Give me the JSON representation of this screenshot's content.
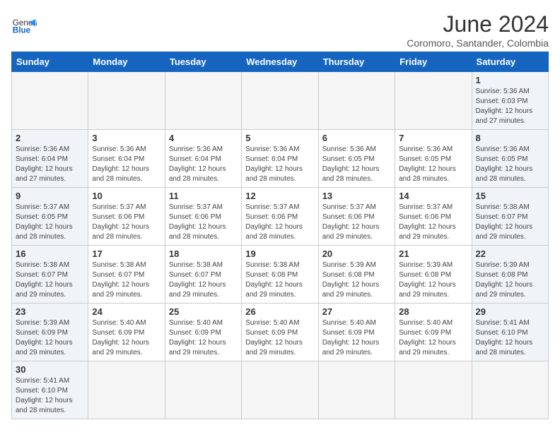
{
  "header": {
    "logo_text_normal": "General",
    "logo_text_blue": "Blue",
    "month_title": "June 2024",
    "subtitle": "Coromoro, Santander, Colombia"
  },
  "weekdays": [
    "Sunday",
    "Monday",
    "Tuesday",
    "Wednesday",
    "Thursday",
    "Friday",
    "Saturday"
  ],
  "weeks": [
    [
      {
        "day": "",
        "info": ""
      },
      {
        "day": "",
        "info": ""
      },
      {
        "day": "",
        "info": ""
      },
      {
        "day": "",
        "info": ""
      },
      {
        "day": "",
        "info": ""
      },
      {
        "day": "",
        "info": ""
      },
      {
        "day": "1",
        "info": "Sunrise: 5:36 AM\nSunset: 6:03 PM\nDaylight: 12 hours\nand 27 minutes."
      }
    ],
    [
      {
        "day": "2",
        "info": "Sunrise: 5:36 AM\nSunset: 6:04 PM\nDaylight: 12 hours\nand 27 minutes."
      },
      {
        "day": "3",
        "info": "Sunrise: 5:36 AM\nSunset: 6:04 PM\nDaylight: 12 hours\nand 28 minutes."
      },
      {
        "day": "4",
        "info": "Sunrise: 5:36 AM\nSunset: 6:04 PM\nDaylight: 12 hours\nand 28 minutes."
      },
      {
        "day": "5",
        "info": "Sunrise: 5:36 AM\nSunset: 6:04 PM\nDaylight: 12 hours\nand 28 minutes."
      },
      {
        "day": "6",
        "info": "Sunrise: 5:36 AM\nSunset: 6:05 PM\nDaylight: 12 hours\nand 28 minutes."
      },
      {
        "day": "7",
        "info": "Sunrise: 5:36 AM\nSunset: 6:05 PM\nDaylight: 12 hours\nand 28 minutes."
      },
      {
        "day": "8",
        "info": "Sunrise: 5:36 AM\nSunset: 6:05 PM\nDaylight: 12 hours\nand 28 minutes."
      }
    ],
    [
      {
        "day": "9",
        "info": "Sunrise: 5:37 AM\nSunset: 6:05 PM\nDaylight: 12 hours\nand 28 minutes."
      },
      {
        "day": "10",
        "info": "Sunrise: 5:37 AM\nSunset: 6:06 PM\nDaylight: 12 hours\nand 28 minutes."
      },
      {
        "day": "11",
        "info": "Sunrise: 5:37 AM\nSunset: 6:06 PM\nDaylight: 12 hours\nand 28 minutes."
      },
      {
        "day": "12",
        "info": "Sunrise: 5:37 AM\nSunset: 6:06 PM\nDaylight: 12 hours\nand 28 minutes."
      },
      {
        "day": "13",
        "info": "Sunrise: 5:37 AM\nSunset: 6:06 PM\nDaylight: 12 hours\nand 29 minutes."
      },
      {
        "day": "14",
        "info": "Sunrise: 5:37 AM\nSunset: 6:06 PM\nDaylight: 12 hours\nand 29 minutes."
      },
      {
        "day": "15",
        "info": "Sunrise: 5:38 AM\nSunset: 6:07 PM\nDaylight: 12 hours\nand 29 minutes."
      }
    ],
    [
      {
        "day": "16",
        "info": "Sunrise: 5:38 AM\nSunset: 6:07 PM\nDaylight: 12 hours\nand 29 minutes."
      },
      {
        "day": "17",
        "info": "Sunrise: 5:38 AM\nSunset: 6:07 PM\nDaylight: 12 hours\nand 29 minutes."
      },
      {
        "day": "18",
        "info": "Sunrise: 5:38 AM\nSunset: 6:07 PM\nDaylight: 12 hours\nand 29 minutes."
      },
      {
        "day": "19",
        "info": "Sunrise: 5:38 AM\nSunset: 6:08 PM\nDaylight: 12 hours\nand 29 minutes."
      },
      {
        "day": "20",
        "info": "Sunrise: 5:39 AM\nSunset: 6:08 PM\nDaylight: 12 hours\nand 29 minutes."
      },
      {
        "day": "21",
        "info": "Sunrise: 5:39 AM\nSunset: 6:08 PM\nDaylight: 12 hours\nand 29 minutes."
      },
      {
        "day": "22",
        "info": "Sunrise: 5:39 AM\nSunset: 6:08 PM\nDaylight: 12 hours\nand 29 minutes."
      }
    ],
    [
      {
        "day": "23",
        "info": "Sunrise: 5:39 AM\nSunset: 6:09 PM\nDaylight: 12 hours\nand 29 minutes."
      },
      {
        "day": "24",
        "info": "Sunrise: 5:40 AM\nSunset: 6:09 PM\nDaylight: 12 hours\nand 29 minutes."
      },
      {
        "day": "25",
        "info": "Sunrise: 5:40 AM\nSunset: 6:09 PM\nDaylight: 12 hours\nand 29 minutes."
      },
      {
        "day": "26",
        "info": "Sunrise: 5:40 AM\nSunset: 6:09 PM\nDaylight: 12 hours\nand 29 minutes."
      },
      {
        "day": "27",
        "info": "Sunrise: 5:40 AM\nSunset: 6:09 PM\nDaylight: 12 hours\nand 29 minutes."
      },
      {
        "day": "28",
        "info": "Sunrise: 5:40 AM\nSunset: 6:09 PM\nDaylight: 12 hours\nand 29 minutes."
      },
      {
        "day": "29",
        "info": "Sunrise: 5:41 AM\nSunset: 6:10 PM\nDaylight: 12 hours\nand 28 minutes."
      }
    ],
    [
      {
        "day": "30",
        "info": "Sunrise: 5:41 AM\nSunset: 6:10 PM\nDaylight: 12 hours\nand 28 minutes."
      },
      {
        "day": "",
        "info": ""
      },
      {
        "day": "",
        "info": ""
      },
      {
        "day": "",
        "info": ""
      },
      {
        "day": "",
        "info": ""
      },
      {
        "day": "",
        "info": ""
      },
      {
        "day": "",
        "info": ""
      }
    ]
  ]
}
